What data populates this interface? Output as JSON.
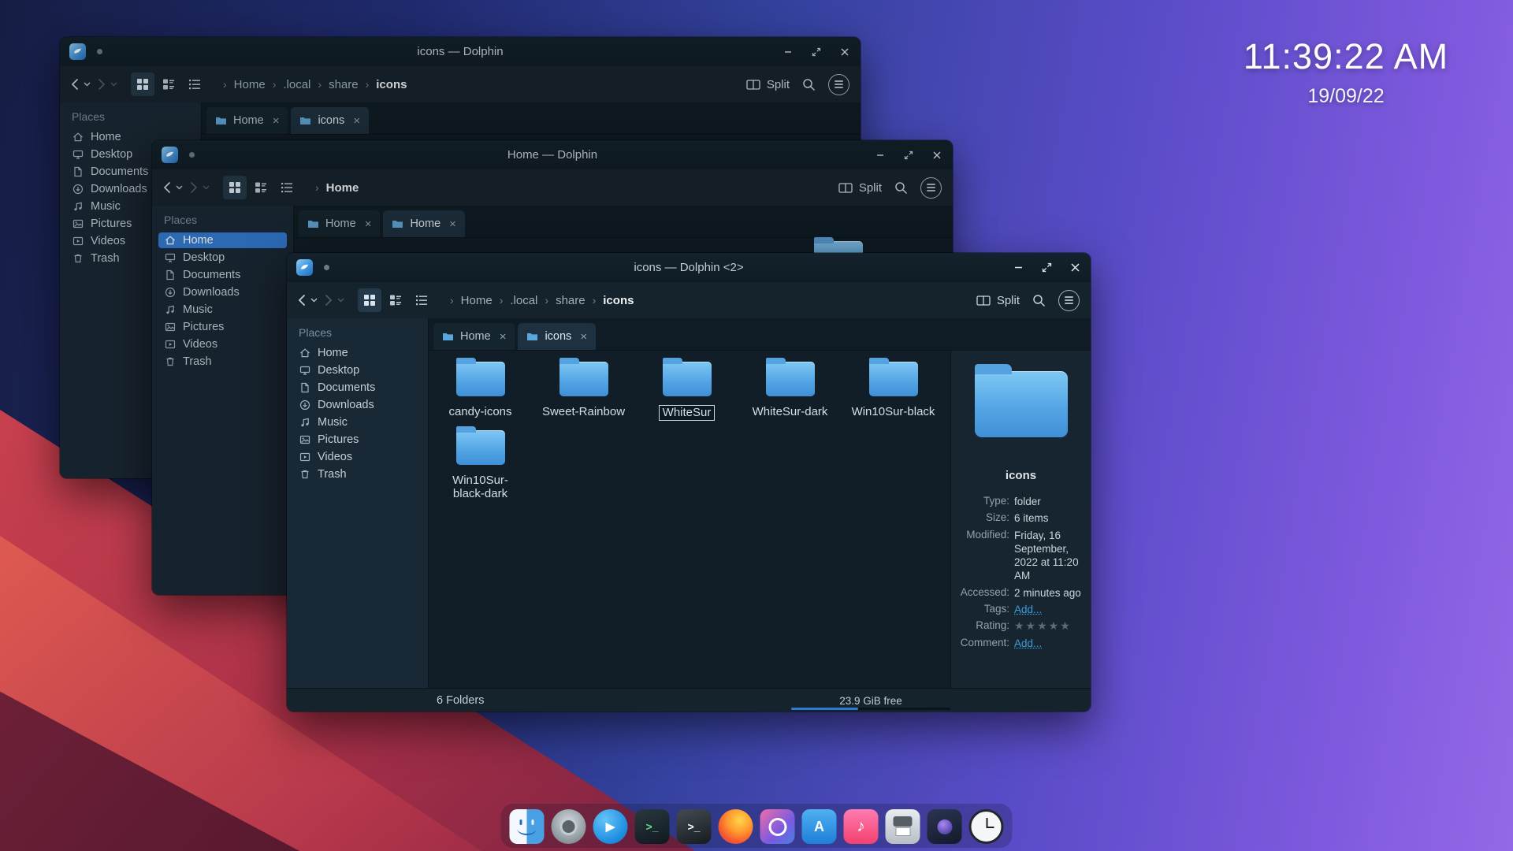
{
  "clock": {
    "time": "11:39:22 AM",
    "date": "19/09/22"
  },
  "ui": {
    "sep": "›",
    "close": "×"
  },
  "toolbar": {
    "split": "Split"
  },
  "places": {
    "header": "Places",
    "items": [
      "Home",
      "Desktop",
      "Documents",
      "Downloads",
      "Music",
      "Pictures",
      "Videos",
      "Trash"
    ]
  },
  "win1": {
    "title": "icons — Dolphin",
    "breadcrumb": [
      "Home",
      ".local",
      "share",
      "icons"
    ],
    "tabs": [
      "Home",
      "icons"
    ]
  },
  "win2": {
    "title": "Home — Dolphin",
    "breadcrumb": [
      "Home"
    ],
    "tabs": [
      "Home",
      "Home"
    ]
  },
  "win3": {
    "title": "icons — Dolphin <2>",
    "breadcrumb": [
      "Home",
      ".local",
      "share",
      "icons"
    ],
    "tabs": [
      "Home",
      "icons"
    ],
    "folders": [
      "candy-icons",
      "Sweet-Rainbow",
      "WhiteSur",
      "WhiteSur-dark",
      "Win10Sur-black",
      "Win10Sur-black-dark"
    ],
    "info": {
      "name": "icons",
      "rows": [
        {
          "label": "Type:",
          "value": "folder"
        },
        {
          "label": "Size:",
          "value": "6 items"
        },
        {
          "label": "Modified:",
          "value": "Friday, 16 September, 2022 at 11:20 AM"
        },
        {
          "label": "Accessed:",
          "value": "2 minutes ago"
        },
        {
          "label": "Tags:",
          "value": "Add..."
        },
        {
          "label": "Rating:",
          "value": "★★★★★"
        },
        {
          "label": "Comment:",
          "value": "Add..."
        }
      ]
    },
    "status": {
      "folders": "6 Folders",
      "free": "23.9 GiB free"
    }
  },
  "dock": {
    "items": [
      {
        "name": "finder",
        "glyph": ""
      },
      {
        "name": "system-settings",
        "glyph": ""
      },
      {
        "name": "media-player",
        "glyph": "▶"
      },
      {
        "name": "console",
        "glyph": ">_"
      },
      {
        "name": "terminal",
        "glyph": ">_"
      },
      {
        "name": "firefox",
        "glyph": ""
      },
      {
        "name": "preferences",
        "glyph": ""
      },
      {
        "name": "app-store",
        "glyph": "A"
      },
      {
        "name": "music",
        "glyph": "♪"
      },
      {
        "name": "printer",
        "glyph": ""
      },
      {
        "name": "screenshot",
        "glyph": ""
      },
      {
        "name": "clock",
        "glyph": ""
      }
    ]
  }
}
